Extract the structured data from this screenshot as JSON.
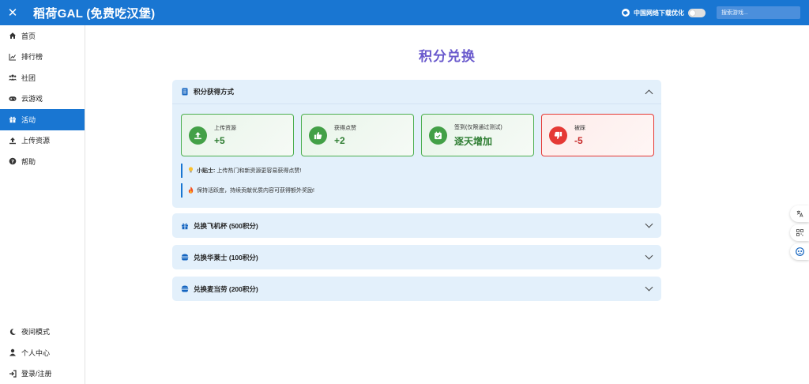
{
  "topbar": {
    "close_label": "✕",
    "title": "稻荷GAL (免费吃汉堡)",
    "net_opt_label": "中国网络下载优化",
    "search_placeholder": "搜索游戏..."
  },
  "sidebar": {
    "items": [
      {
        "label": "首页",
        "icon": "home-icon"
      },
      {
        "label": "排行榜",
        "icon": "chart-icon"
      },
      {
        "label": "社团",
        "icon": "group-icon"
      },
      {
        "label": "云游戏",
        "icon": "gamepad-icon"
      },
      {
        "label": "活动",
        "icon": "gift-icon",
        "active": true
      },
      {
        "label": "上传资源",
        "icon": "upload-icon"
      },
      {
        "label": "帮助",
        "icon": "help-icon"
      }
    ],
    "bottom_items": [
      {
        "label": "夜间模式",
        "icon": "moon-icon"
      },
      {
        "label": "个人中心",
        "icon": "user-icon"
      },
      {
        "label": "登录/注册",
        "icon": "login-icon"
      }
    ]
  },
  "main": {
    "title": "积分兑换",
    "earn_panel": {
      "title": "积分获得方式",
      "cards": [
        {
          "label": "上传资源",
          "value": "+5",
          "icon": "upload-icon",
          "tone": "green"
        },
        {
          "label": "获得点赞",
          "value": "+2",
          "icon": "thumbs-up-icon",
          "tone": "green"
        },
        {
          "label": "签到(仅限通过测试)",
          "value": "逐天增加",
          "icon": "calendar-check-icon",
          "tone": "green"
        },
        {
          "label": "被踩",
          "value": "-5",
          "icon": "thumbs-down-icon",
          "tone": "red"
        }
      ],
      "tip1_bold": "小贴士:",
      "tip1_text": "上传热门和新资源更容易获得点赞!",
      "tip2_text": "保持活跃度，持续贡献优质内容可获得额外奖励!"
    },
    "redeem_panels": [
      {
        "title": "兑换飞机杯 (500积分)",
        "icon": "gift-icon"
      },
      {
        "title": "兑换华莱士 (100积分)",
        "icon": "burger-icon"
      },
      {
        "title": "兑换麦当劳 (200积分)",
        "icon": "burger-icon"
      }
    ]
  },
  "colors": {
    "primary": "#1976d2",
    "title_purple": "#6a5acd",
    "green": "#43a047",
    "red": "#e53935",
    "panel_bg": "#e3f0fb"
  }
}
